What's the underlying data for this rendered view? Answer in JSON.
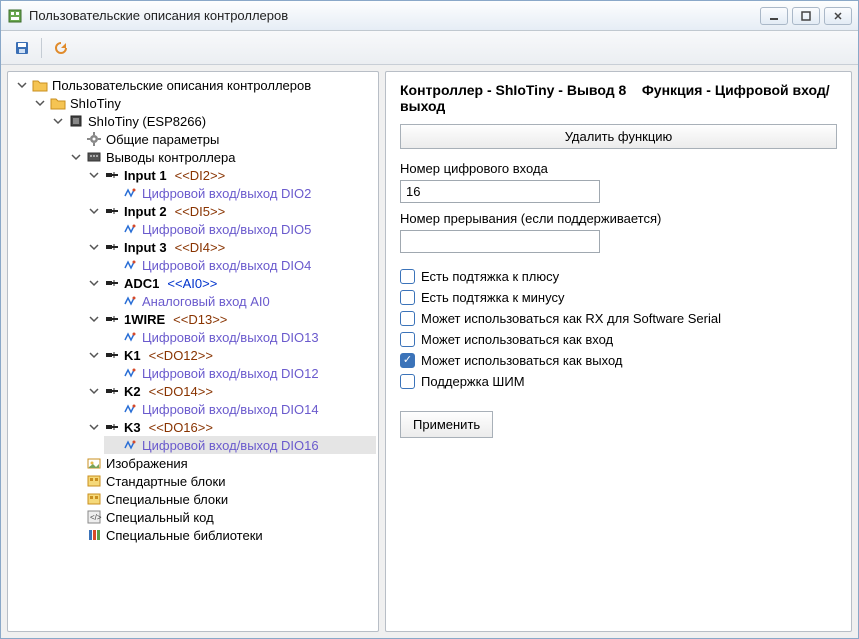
{
  "window": {
    "title": "Пользовательские описания контроллеров"
  },
  "toolbar": {
    "save_tip": "Сохранить",
    "refresh_tip": "Обновить"
  },
  "tree": {
    "root": {
      "label": "Пользовательские описания контроллеров",
      "children": [
        {
          "label": "ShIoTiny",
          "icon": "folder",
          "children": [
            {
              "label": "ShIoTiny (ESP8266)",
              "icon": "chip",
              "children": [
                {
                  "label": "Общие параметры",
                  "icon": "gear",
                  "leaf": true
                },
                {
                  "label": "Выводы контроллера",
                  "icon": "board",
                  "children": [
                    {
                      "label": "Input 1",
                      "alias": "<<DI2>>",
                      "alias_cls": "brown",
                      "icon": "pin",
                      "children": [
                        {
                          "label": "Цифровой вход/выход DIO2",
                          "icon": "io",
                          "leaf": true
                        }
                      ]
                    },
                    {
                      "label": "Input 2",
                      "alias": "<<DI5>>",
                      "alias_cls": "brown",
                      "icon": "pin",
                      "children": [
                        {
                          "label": "Цифровой вход/выход DIO5",
                          "icon": "io",
                          "leaf": true
                        }
                      ]
                    },
                    {
                      "label": "Input 3",
                      "alias": "<<DI4>>",
                      "alias_cls": "brown",
                      "icon": "pin",
                      "children": [
                        {
                          "label": "Цифровой вход/выход DIO4",
                          "icon": "io",
                          "leaf": true
                        }
                      ]
                    },
                    {
                      "label": "ADC1",
                      "alias": "<<AI0>>",
                      "alias_cls": "blue",
                      "icon": "pin",
                      "children": [
                        {
                          "label": "Аналоговый вход AI0",
                          "icon": "io",
                          "leaf": true
                        }
                      ]
                    },
                    {
                      "label": "1WIRE",
                      "alias": "<<D13>>",
                      "alias_cls": "brown",
                      "icon": "pin",
                      "children": [
                        {
                          "label": "Цифровой вход/выход DIO13",
                          "icon": "io",
                          "leaf": true
                        }
                      ]
                    },
                    {
                      "label": "K1",
                      "alias": "<<DO12>>",
                      "alias_cls": "brown",
                      "icon": "pin",
                      "children": [
                        {
                          "label": "Цифровой вход/выход DIO12",
                          "icon": "io",
                          "leaf": true
                        }
                      ]
                    },
                    {
                      "label": "K2",
                      "alias": "<<DO14>>",
                      "alias_cls": "brown",
                      "icon": "pin",
                      "children": [
                        {
                          "label": "Цифровой вход/выход DIO14",
                          "icon": "io",
                          "leaf": true
                        }
                      ]
                    },
                    {
                      "label": "K3",
                      "alias": "<<DO16>>",
                      "alias_cls": "brown",
                      "icon": "pin",
                      "children": [
                        {
                          "label": "Цифровой вход/выход DIO16",
                          "icon": "io",
                          "leaf": true,
                          "selected": true
                        }
                      ]
                    }
                  ]
                },
                {
                  "label": "Изображения",
                  "icon": "images",
                  "leaf": true
                },
                {
                  "label": "Стандартные блоки",
                  "icon": "blocks",
                  "leaf": true
                },
                {
                  "label": "Специальные блоки",
                  "icon": "blocks",
                  "leaf": true
                },
                {
                  "label": "Специальный код",
                  "icon": "code",
                  "leaf": true
                },
                {
                  "label": "Специальные библиотеки",
                  "icon": "libs",
                  "leaf": true
                }
              ]
            }
          ]
        }
      ]
    }
  },
  "form": {
    "header_ctrl": "Контроллер - ShIoTiny - Вывод 8",
    "header_func": "Функция - Цифровой вход/выход",
    "delete_btn": "Удалить функцию",
    "din_label": "Номер цифрового входа",
    "din_value": "16",
    "irq_label": "Номер прерывания (если поддерживается)",
    "irq_value": "",
    "checks": [
      {
        "label": "Есть подтяжка к плюсу",
        "checked": false
      },
      {
        "label": "Есть подтяжка к минусу",
        "checked": false
      },
      {
        "label": "Может использоваться как RX для Software Serial",
        "checked": false
      },
      {
        "label": "Может использоваться как вход",
        "checked": false
      },
      {
        "label": "Может использоваться как выход",
        "checked": true
      },
      {
        "label": "Поддержка ШИМ",
        "checked": false
      }
    ],
    "apply": "Применить"
  }
}
